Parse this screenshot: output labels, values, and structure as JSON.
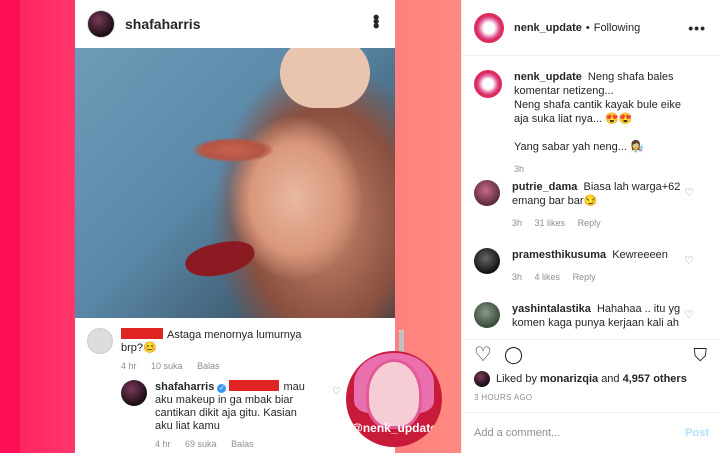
{
  "post_image": {
    "inner_header": {
      "username": "shafaharris"
    },
    "comments": [
      {
        "text": "Astaga menornya lumurnya brp?😊",
        "time": "4 hr",
        "likes": "10 suka",
        "reply": "Balas"
      },
      {
        "username": "shafaharris",
        "text": "mau aku makeup in ga mbak biar cantikan dikit aja gitu. Kasian aku liat kamu",
        "time": "4 hr",
        "likes": "69 suka",
        "reply": "Balas"
      }
    ],
    "watermark": "@nenk_update"
  },
  "sidebar": {
    "header": {
      "username": "nenk_update",
      "separator": "•",
      "follow_status": "Following"
    },
    "caption": {
      "username": "nenk_update",
      "line1": "Neng shafa bales komentar netizeng...",
      "line2": "Neng shafa cantik kayak bule eike aja suka liat nya... 😍😍",
      "line3": "Yang sabar yah neng... 👩‍🔬",
      "time": "3h"
    },
    "comments": [
      {
        "username": "putrie_dama",
        "text": "Biasa lah warga+62 emang bar bar😏",
        "time": "3h",
        "likes": "31 likes",
        "reply": "Reply"
      },
      {
        "username": "pramesthikusuma",
        "text": "Kewreeeen",
        "time": "3h",
        "likes": "4 likes",
        "reply": "Reply"
      },
      {
        "username": "yashintalastika",
        "text": "Hahahaa .. itu yg komen kaga punya kerjaan kali ah"
      }
    ],
    "likes": {
      "prefix": "Liked by",
      "user": "monarizqia",
      "and": "and",
      "count": "4,957 others"
    },
    "timestamp": "3 HOURS AGO",
    "add_comment": {
      "placeholder": "Add a comment...",
      "post_label": "Post"
    }
  },
  "colors": {
    "accent_pink": "#ff1f5e",
    "link_blue": "#b2dffc",
    "verified": "#3897f0"
  },
  "icons": [
    "more-icon",
    "heart-icon",
    "comment-icon",
    "bookmark-icon",
    "verified-icon"
  ]
}
